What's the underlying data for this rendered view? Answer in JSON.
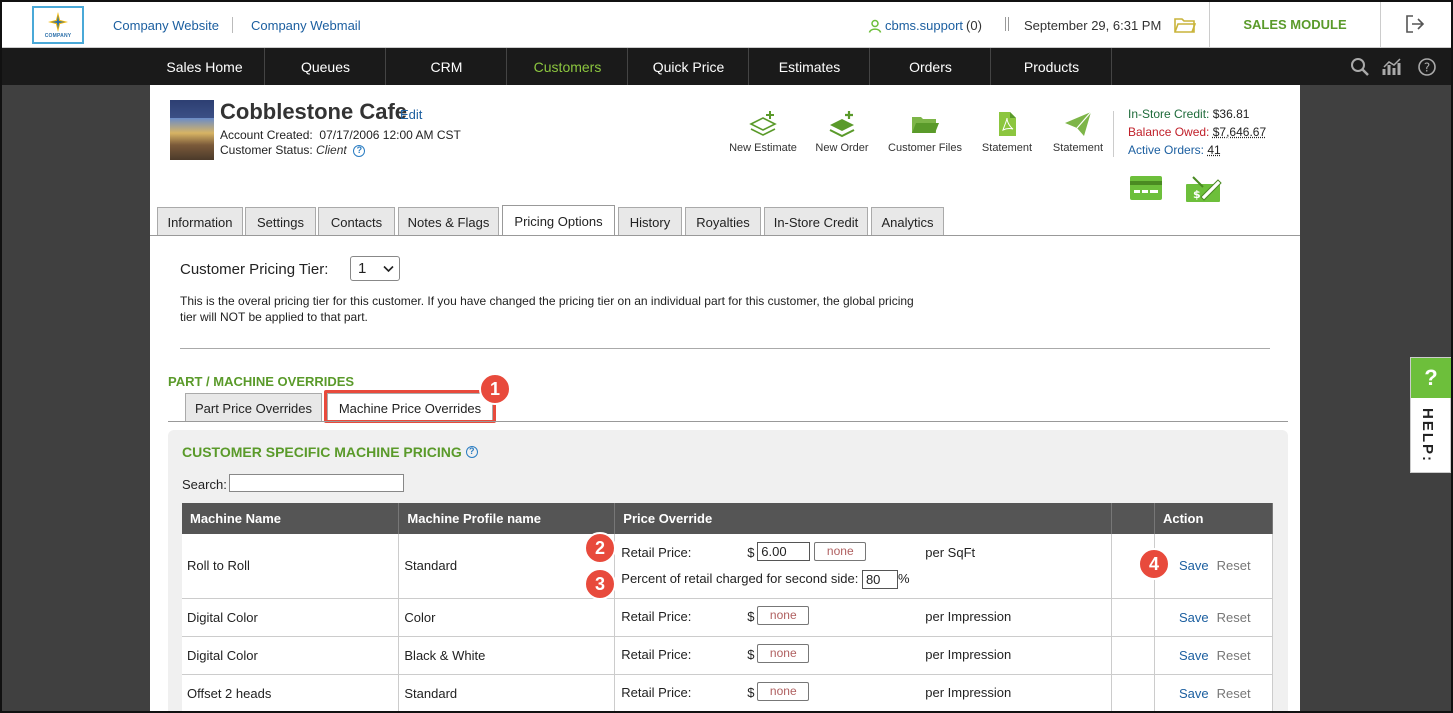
{
  "header": {
    "logo_text": "COMPANY",
    "links": [
      "Company Website",
      "Company Webmail"
    ],
    "user": "cbms.support",
    "user_count": "(0)",
    "datetime": "September 29, 6:31 PM",
    "module": "SALES MODULE"
  },
  "nav": {
    "items": [
      "Sales Home",
      "Queues",
      "CRM",
      "Customers",
      "Quick Price",
      "Estimates",
      "Orders",
      "Products"
    ],
    "active": "Customers",
    "icons": [
      "search-icon",
      "stats-icon",
      "help-icon"
    ]
  },
  "customer": {
    "name": "Cobblestone Cafe",
    "edit": "Edit",
    "created_label": "Account Created:",
    "created": "07/17/2006 12:00 AM CST",
    "status_label": "Customer Status:",
    "status": "Client"
  },
  "actions": [
    {
      "label": "New Estimate",
      "icon": "layers-plus-icon"
    },
    {
      "label": "New Order",
      "icon": "stack-plus-icon"
    },
    {
      "label": "Customer Files",
      "icon": "folder-icon"
    },
    {
      "label": "Statement",
      "icon": "pdf-icon"
    },
    {
      "label": "Statement",
      "icon": "send-icon"
    }
  ],
  "credits": {
    "instore_label": "In-Store Credit:",
    "instore": "$36.81",
    "balance_label": "Balance Owed:",
    "balance": "$7,646.67",
    "active_label": "Active Orders:",
    "active": "41"
  },
  "tabs": [
    "Information",
    "Settings",
    "Contacts",
    "Notes & Flags",
    "Pricing Options",
    "History",
    "Royalties",
    "In-Store Credit",
    "Analytics"
  ],
  "active_tab": "Pricing Options",
  "pricing": {
    "tier_label": "Customer Pricing Tier:",
    "tier_value": "1",
    "tier_desc": "This is the overal pricing tier for this customer. If you have changed the pricing tier on an individual part for this customer, the global pricing tier will NOT be applied to that part.",
    "overrides_title": "PART / MACHINE OVERRIDES",
    "subtabs": [
      "Part Price Overrides",
      "Machine Price Overrides"
    ],
    "panel_title": "CUSTOMER SPECIFIC MACHINE PRICING",
    "search_label": "Search:"
  },
  "table": {
    "headers": [
      "Machine Name",
      "Machine Profile name",
      "Price Override",
      "",
      "Action"
    ],
    "rows": [
      {
        "machine": "Roll to Roll",
        "profile": "Standard",
        "retail_label": "Retail Price:",
        "currency": "$",
        "price": "6.00",
        "none": "none",
        "unit": "per SqFt",
        "second_label": "Percent of retail charged for second side:",
        "second_value": "80",
        "pct": "%",
        "save": "Save",
        "reset": "Reset"
      },
      {
        "machine": "Digital Color",
        "profile": "Color",
        "retail_label": "Retail Price:",
        "currency": "$",
        "none": "none",
        "unit": "per Impression",
        "save": "Save",
        "reset": "Reset"
      },
      {
        "machine": "Digital Color",
        "profile": "Black & White",
        "retail_label": "Retail Price:",
        "currency": "$",
        "none": "none",
        "unit": "per Impression",
        "save": "Save",
        "reset": "Reset"
      },
      {
        "machine": "Offset 2 heads",
        "profile": "Standard",
        "retail_label": "Retail Price:",
        "currency": "$",
        "none": "none",
        "unit": "per Impression",
        "save": "Save",
        "reset": "Reset"
      }
    ]
  },
  "badges": [
    "1",
    "2",
    "3",
    "4"
  ],
  "help": {
    "q": "?",
    "label": "HELP:"
  },
  "colors": {
    "accent_green": "#5a9a2a",
    "link_blue": "#1c5fa0",
    "badge_red": "#e84a3c",
    "nav_bg": "#1a1a1a"
  }
}
